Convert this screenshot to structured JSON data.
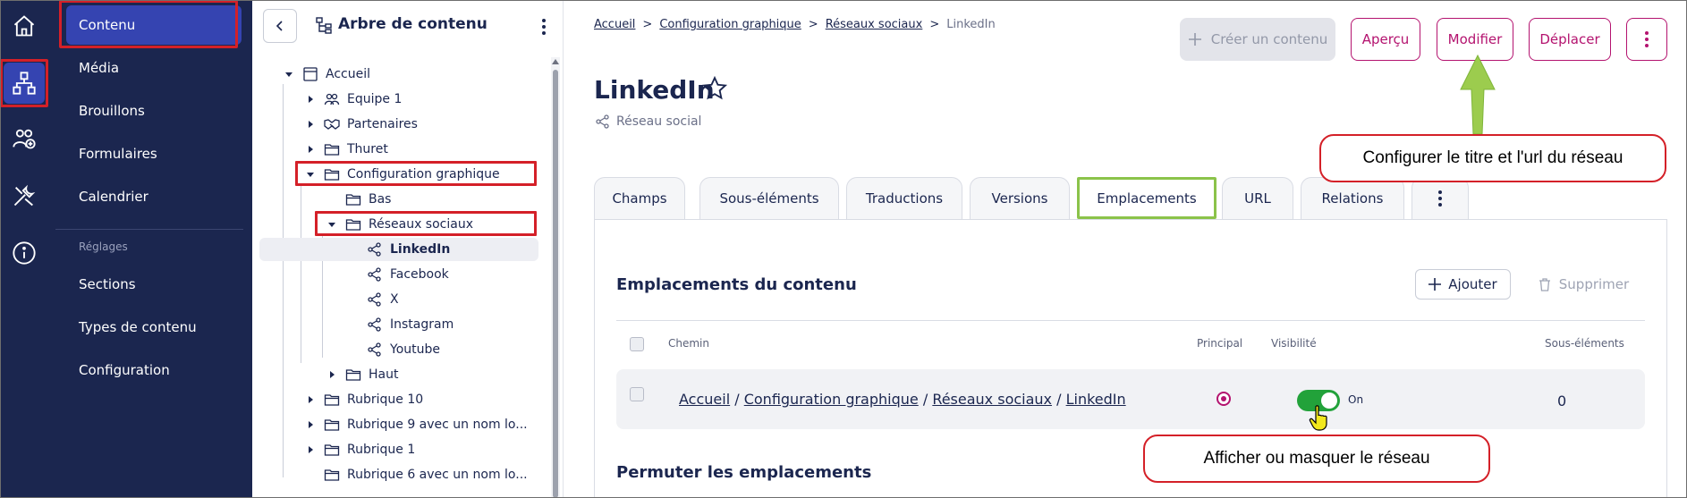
{
  "rail": {
    "items": [
      "home-icon",
      "content-tree-icon",
      "users-icon",
      "tools-icon",
      "info-icon"
    ]
  },
  "sidebar": {
    "items": [
      "Contenu",
      "Média",
      "Brouillons",
      "Formulaires",
      "Calendrier"
    ],
    "settings_heading": "Réglages",
    "settings_items": [
      "Sections",
      "Types de contenu",
      "Configuration"
    ]
  },
  "tree": {
    "title": "Arbre de contenu",
    "nodes": [
      "Accueil",
      "Equipe 1",
      "Partenaires",
      "Thuret",
      "Configuration graphique",
      "Bas",
      "Réseaux sociaux",
      "LinkedIn",
      "Facebook",
      "X",
      "Instagram",
      "Youtube",
      "Haut",
      "Rubrique 10",
      "Rubrique 9 avec un nom lo...",
      "Rubrique 1",
      "Rubrique 6 avec un nom lo..."
    ]
  },
  "breadcrumb": {
    "items": [
      "Accueil",
      "Configuration graphique",
      "Réseaux sociaux"
    ],
    "current": "LinkedIn",
    "separator": ">"
  },
  "toolbar": {
    "create": "Créer un contenu",
    "preview": "Aperçu",
    "edit": "Modifier",
    "move": "Déplacer"
  },
  "page": {
    "title": "LinkedIn",
    "content_type": "Réseau social"
  },
  "tabs": [
    "Champs",
    "Sous-éléments",
    "Traductions",
    "Versions",
    "Emplacements",
    "URL",
    "Relations"
  ],
  "locations": {
    "title": "Emplacements du contenu",
    "add": "Ajouter",
    "delete": "Supprimer",
    "columns": {
      "path": "Chemin",
      "main": "Principal",
      "visibility": "Visibilité",
      "children": "Sous-éléments"
    },
    "row": {
      "path": [
        "Accueil",
        "Configuration graphique",
        "Réseaux sociaux",
        "LinkedIn"
      ],
      "path_separator": "/",
      "visibility_label": "On",
      "children": "0"
    },
    "swap_title": "Permuter les emplacements"
  },
  "annotations": {
    "edit_hint": "Configurer le titre et l'url du réseau",
    "visibility_hint": "Afficher ou masquer le réseau"
  },
  "colors": {
    "navy": "#1b264f",
    "active_blue": "#3544b1",
    "accent": "#b4136f",
    "toggle_on": "#22a23a",
    "highlight_red": "#d42028",
    "highlight_green": "#8bc34a"
  }
}
